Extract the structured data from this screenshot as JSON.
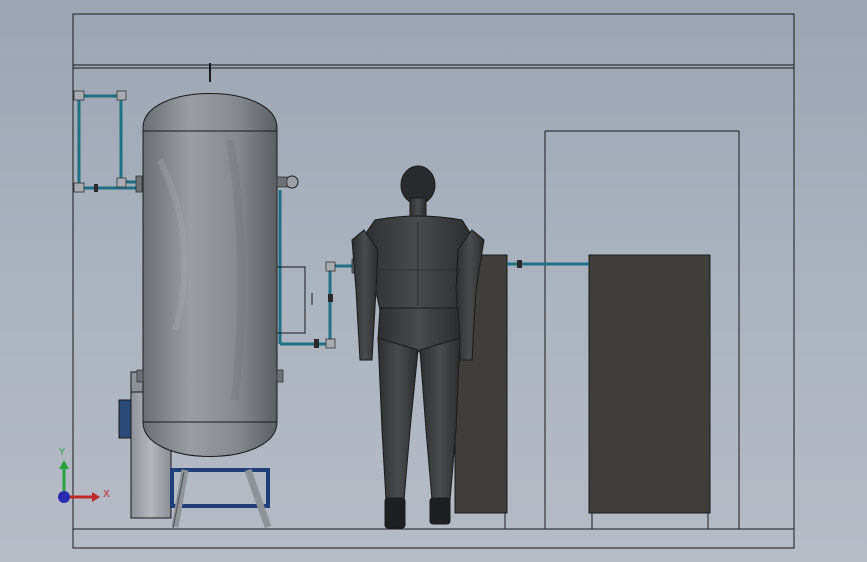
{
  "viewport": {
    "title": "",
    "background_top": "#9ba5b3",
    "background_bottom": "#b6bcc6"
  },
  "triad": {
    "x_label": "X",
    "y_label": "Y",
    "x_color": "#c0282a",
    "y_color": "#2aa040",
    "origin_color": "#2a2ab0"
  },
  "colors": {
    "pipe": "#1f6f85",
    "tank_body": "#8a8e93",
    "tank_shade": "#5e6267",
    "cabinet": "#3f3e3a",
    "figure": "#3a3b3c",
    "edge": "#1a1a1a"
  },
  "components": [
    {
      "name": "air-receiver-tank",
      "kind": "vertical pressure vessel"
    },
    {
      "name": "dryer-unit",
      "kind": "small cylinder unit"
    },
    {
      "name": "mannequin",
      "kind": "human figure"
    },
    {
      "name": "cabinet-middle",
      "kind": "cabinet"
    },
    {
      "name": "cabinet-right",
      "kind": "cabinet"
    },
    {
      "name": "doorway",
      "kind": "opening"
    }
  ]
}
